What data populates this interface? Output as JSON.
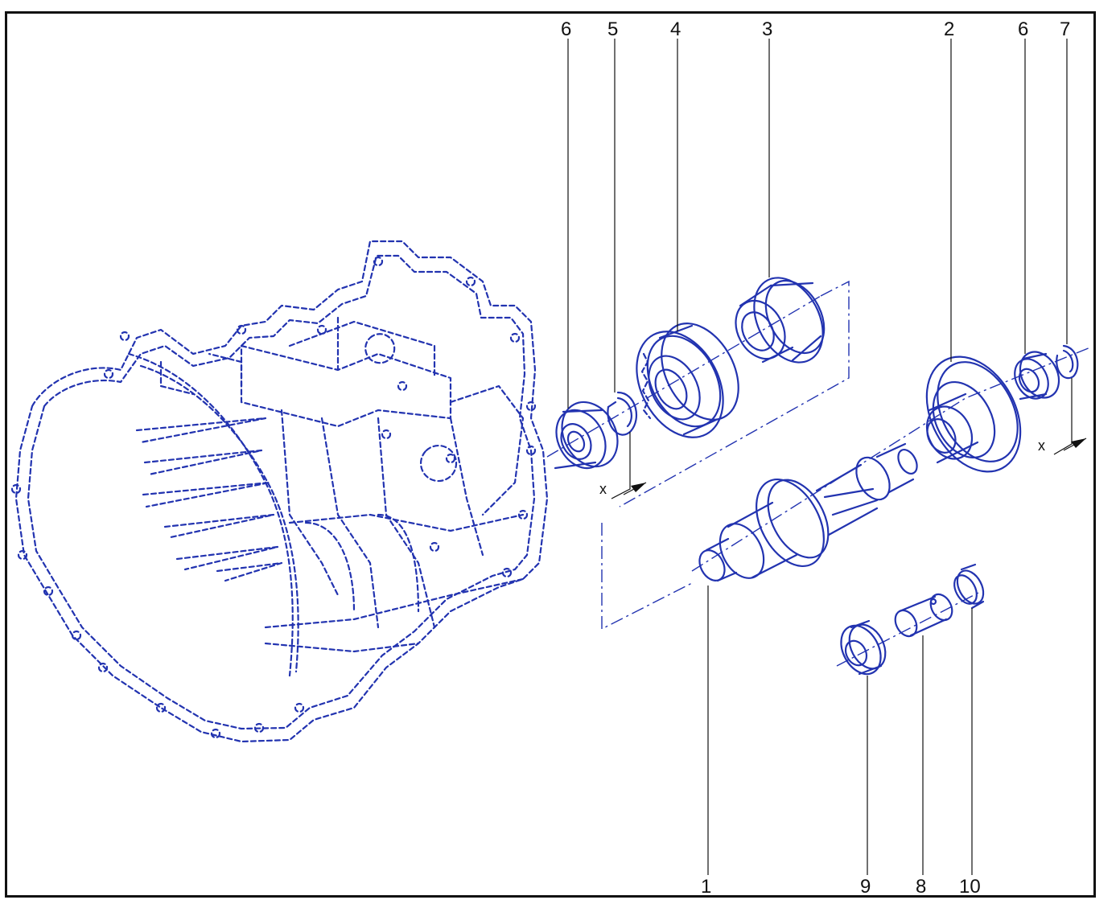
{
  "diagram": {
    "colors": {
      "line": "#2233b0",
      "labels": "#111111",
      "frame": "#111111"
    },
    "callouts": [
      {
        "id": "top-6a",
        "text": "6"
      },
      {
        "id": "top-5",
        "text": "5"
      },
      {
        "id": "top-4",
        "text": "4"
      },
      {
        "id": "top-3",
        "text": "3"
      },
      {
        "id": "top-2",
        "text": "2"
      },
      {
        "id": "top-6b",
        "text": "6"
      },
      {
        "id": "top-7",
        "text": "7"
      },
      {
        "id": "bot-1",
        "text": "1"
      },
      {
        "id": "bot-9",
        "text": "9"
      },
      {
        "id": "bot-8",
        "text": "8"
      },
      {
        "id": "bot-10",
        "text": "10"
      }
    ],
    "markers": [
      {
        "id": "x-left",
        "text": "x"
      },
      {
        "id": "x-right",
        "text": "x"
      }
    ]
  }
}
